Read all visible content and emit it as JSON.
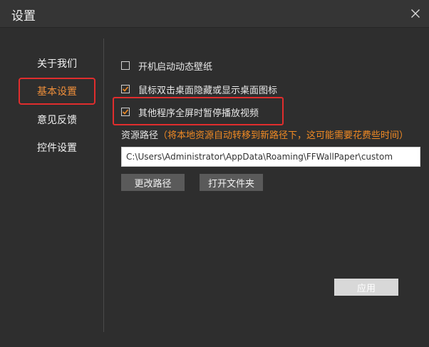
{
  "window": {
    "title": "设置"
  },
  "sidebar": {
    "items": [
      {
        "label": "关于我们",
        "active": false
      },
      {
        "label": "基本设置",
        "active": true
      },
      {
        "label": "意见反馈",
        "active": false
      },
      {
        "label": "控件设置",
        "active": false
      }
    ]
  },
  "settings": {
    "autostart": {
      "label": "开机启动动态壁纸",
      "checked": false
    },
    "double_click_hide_icons": {
      "label": "鼠标双击桌面隐藏或显示桌面图标",
      "checked": true
    },
    "pause_on_fullscreen": {
      "label": "其他程序全屏时暂停播放视频",
      "checked": true
    }
  },
  "resource_path": {
    "label": "资源路径",
    "note": "（将本地资源自动转移到新路径下，这可能需要花费些时间）",
    "value": "C:\\Users\\Administrator\\AppData\\Roaming\\FFWallPaper\\custom"
  },
  "buttons": {
    "change_path": "更改路径",
    "open_folder": "打开文件夹",
    "apply": "应用"
  },
  "colors": {
    "accent": "#ef8f3a",
    "highlight_box": "#e02d2d",
    "background": "#2e2e2e"
  },
  "icons": {
    "close": "close-icon",
    "checkbox_checked": "checkmark-icon"
  }
}
